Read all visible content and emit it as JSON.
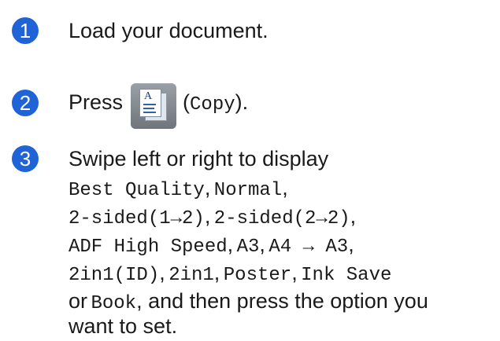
{
  "steps": [
    {
      "number": "1",
      "text": "Load your document."
    },
    {
      "number": "2",
      "press_label": "Press",
      "icon_name": "copy-icon",
      "icon_letter": "A",
      "paren_open": "(",
      "copy_code": "Copy",
      "paren_close": ")."
    },
    {
      "number": "3",
      "intro": "Swipe left or right to display",
      "options": [
        "Best Quality",
        "Normal",
        "2-sided(1→2)",
        "2-sided(2→2)",
        "ADF High Speed",
        "A3",
        "A4 → A3",
        "2in1(ID)",
        "2in1",
        "Poster",
        "Ink Save",
        "Book"
      ],
      "sep": ",",
      "or_word": "or",
      "tail_1": ", and then press the option you",
      "tail_2": "want to set."
    }
  ],
  "colors": {
    "badge": "#1f63d6",
    "text": "#1a1a1a"
  }
}
